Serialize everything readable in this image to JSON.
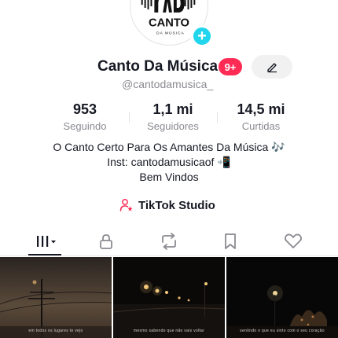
{
  "profile": {
    "logo_text": "CANTO",
    "logo_sub": "DA MÚSICA",
    "display_name": "Canto Da Música",
    "notification_count": "9+",
    "username": "@cantodamusica_"
  },
  "stats": [
    {
      "value": "953",
      "label": "Seguindo"
    },
    {
      "value": "1,1 mi",
      "label": "Seguidores"
    },
    {
      "value": "14,5 mi",
      "label": "Curtidas"
    }
  ],
  "bio": {
    "line1": "O Canto Certo Para Os Amantes Da Música 🎶",
    "line2": "Inst: cantodamusicaof 📲",
    "line3": "Bem Vindos"
  },
  "studio": {
    "label": "TikTok Studio"
  },
  "tabs": [
    {
      "name": "videos",
      "icon": "grid-icon"
    },
    {
      "name": "private",
      "icon": "lock-icon"
    },
    {
      "name": "reposts",
      "icon": "repost-icon"
    },
    {
      "name": "favorites",
      "icon": "bookmark-icon"
    },
    {
      "name": "liked",
      "icon": "heart-icon"
    }
  ],
  "videos": [
    {
      "caption": "em todos os lugares te vejo"
    },
    {
      "caption": "mesmo sabendo que não vais voltar"
    },
    {
      "caption": "sentindo o que eu sinto com o seu coração"
    }
  ],
  "colors": {
    "accent": "#fe2c55",
    "plus_badge": "#20d5ec",
    "text_primary": "#161823",
    "text_secondary": "#8a8b91"
  }
}
